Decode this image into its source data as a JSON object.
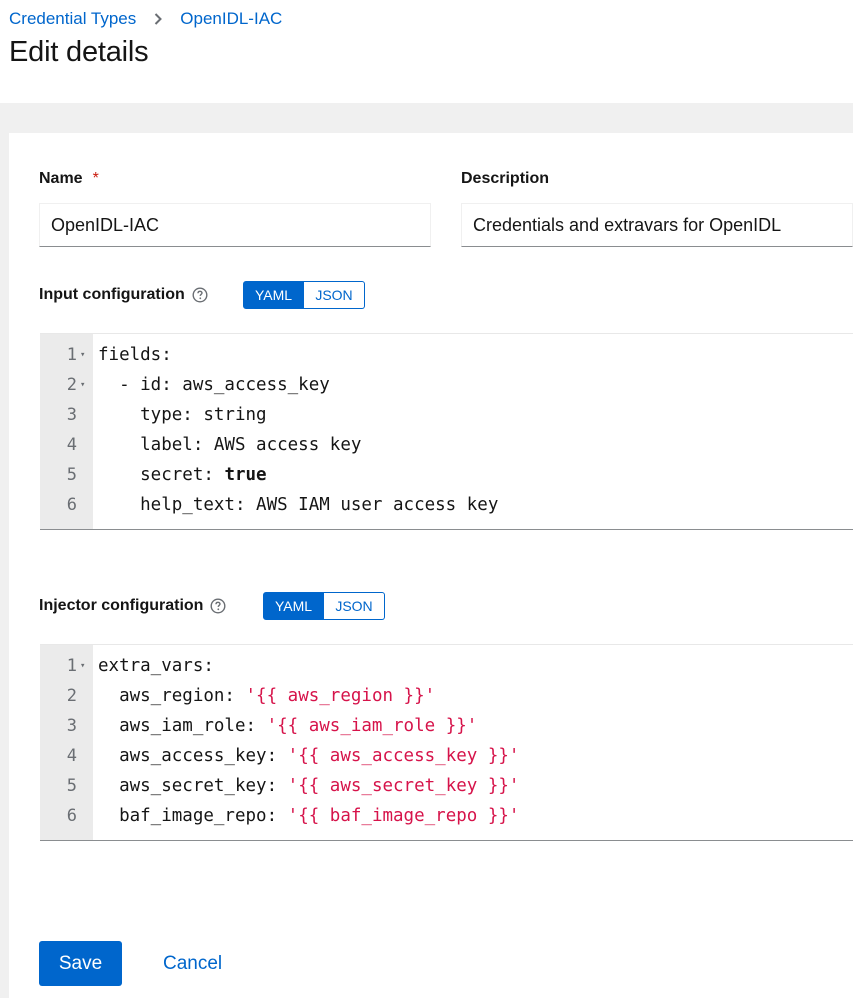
{
  "breadcrumb": {
    "items": [
      "Credential Types",
      "OpenIDL-IAC"
    ]
  },
  "page": {
    "title": "Edit details"
  },
  "form": {
    "name_label": "Name",
    "required_mark": "*",
    "name_value": "OpenIDL-IAC",
    "description_label": "Description",
    "description_value": "Credentials and extravars for OpenIDL",
    "input_config_label": "Input configuration",
    "injector_config_label": "Injector configuration",
    "toggle": {
      "yaml": "YAML",
      "json": "JSON",
      "selected": "YAML"
    }
  },
  "input_editor": {
    "lines": [
      {
        "n": "1",
        "fold": true,
        "tokens": [
          [
            "",
            "fields:"
          ]
        ]
      },
      {
        "n": "2",
        "fold": true,
        "tokens": [
          [
            "",
            "  - id: aws_access_key"
          ]
        ]
      },
      {
        "n": "3",
        "fold": false,
        "tokens": [
          [
            "",
            "    type: string"
          ]
        ]
      },
      {
        "n": "4",
        "fold": false,
        "tokens": [
          [
            "",
            "    label: AWS access key"
          ]
        ]
      },
      {
        "n": "5",
        "fold": false,
        "tokens": [
          [
            "",
            "    secret: "
          ],
          [
            "kw",
            "true"
          ]
        ]
      },
      {
        "n": "6",
        "fold": false,
        "tokens": [
          [
            "",
            "    help_text: AWS IAM user access key"
          ]
        ]
      }
    ]
  },
  "injector_editor": {
    "lines": [
      {
        "n": "1",
        "fold": true,
        "tokens": [
          [
            "",
            "extra_vars:"
          ]
        ]
      },
      {
        "n": "2",
        "fold": false,
        "tokens": [
          [
            "",
            "  aws_region: "
          ],
          [
            "str",
            "'{{ aws_region }}'"
          ]
        ]
      },
      {
        "n": "3",
        "fold": false,
        "tokens": [
          [
            "",
            "  aws_iam_role: "
          ],
          [
            "str",
            "'{{ aws_iam_role }}'"
          ]
        ]
      },
      {
        "n": "4",
        "fold": false,
        "tokens": [
          [
            "",
            "  aws_access_key: "
          ],
          [
            "str",
            "'{{ aws_access_key }}'"
          ]
        ]
      },
      {
        "n": "5",
        "fold": false,
        "tokens": [
          [
            "",
            "  aws_secret_key: "
          ],
          [
            "str",
            "'{{ aws_secret_key }}'"
          ]
        ]
      },
      {
        "n": "6",
        "fold": false,
        "tokens": [
          [
            "",
            "  baf_image_repo: "
          ],
          [
            "str",
            "'{{ baf_image_repo }}'"
          ]
        ]
      }
    ]
  },
  "actions": {
    "save": "Save",
    "cancel": "Cancel"
  },
  "icons": {
    "separator": "chevron-right-icon",
    "help": "help-circle-icon",
    "fold": "fold-caret-icon"
  },
  "colors": {
    "primary": "#0066cc",
    "required": "#c9190b",
    "string": "#d6134a"
  }
}
